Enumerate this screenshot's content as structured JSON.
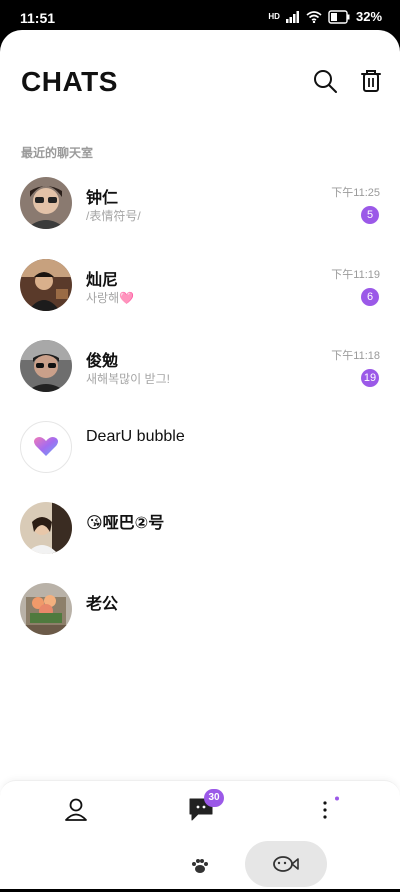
{
  "status_bar": {
    "time": "11:51",
    "network": "HD",
    "battery": "32"
  },
  "header": {
    "title": "CHATS"
  },
  "section": {
    "label": "最近的聊天室"
  },
  "chats": [
    {
      "name": "钟仁",
      "preview": "/表情符号/",
      "time": "下午11:25",
      "unread": "5"
    },
    {
      "name": "灿尼",
      "preview": "사랑해",
      "preview_emoji": "🩷",
      "time": "下午11:19",
      "unread": "6"
    },
    {
      "name": "俊勉",
      "preview": "새해복많이 받그!",
      "time": "下午11:18",
      "unread": "19"
    },
    {
      "name": "DearU bubble"
    },
    {
      "name": "😘哑巴②号"
    },
    {
      "name": "老公"
    }
  ],
  "tabbar": {
    "chat_badge": "30"
  },
  "colors": {
    "accent": "#9b59e8",
    "background": "#ffffff",
    "text": "#111111",
    "muted": "#9a9a9a"
  }
}
